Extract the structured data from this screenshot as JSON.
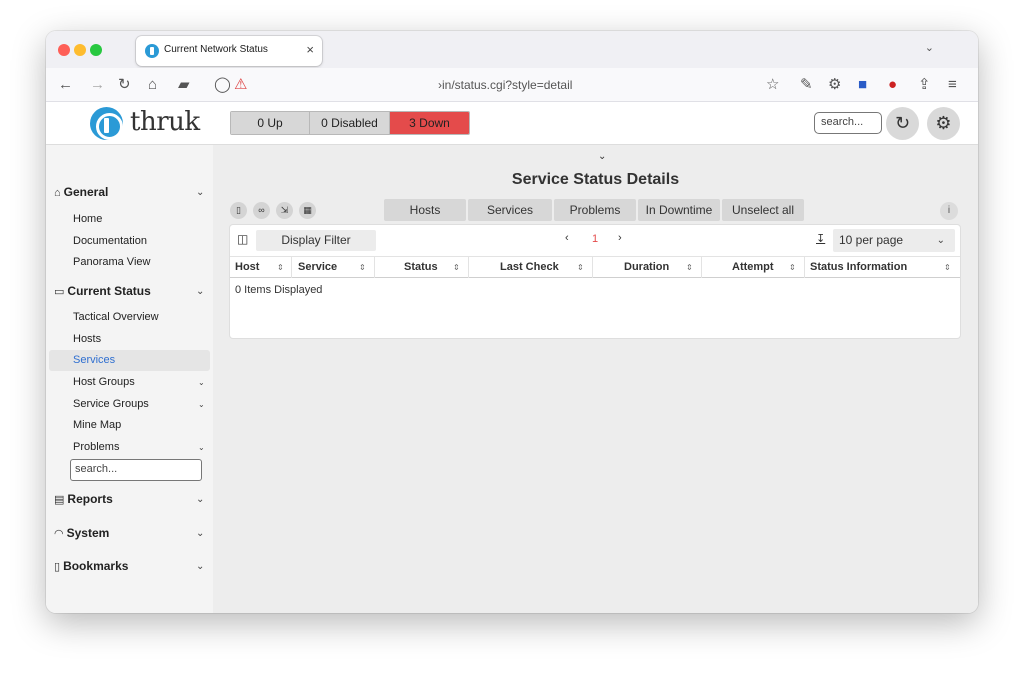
{
  "browser": {
    "tab_title": "Current Network Status",
    "tab_close": "×",
    "tab_list": "⌄",
    "url": "›in/status.cgi?style=detail"
  },
  "header": {
    "logo_text": "thruk",
    "status_up": "0 Up",
    "status_disabled": "0 Disabled",
    "status_down": "3 Down",
    "status_down_color": "#e44b4b",
    "search_placeholder": "search..."
  },
  "sidebar": {
    "sections": [
      {
        "label": "General",
        "icon": "home-icon"
      },
      {
        "label": "Current Status",
        "icon": "monitor-icon"
      },
      {
        "label": "Reports",
        "icon": "report-icon"
      },
      {
        "label": "System",
        "icon": "gauge-icon"
      },
      {
        "label": "Bookmarks",
        "icon": "bookmark-icon"
      }
    ],
    "general_items": [
      "Home",
      "Documentation",
      "Panorama View"
    ],
    "status_items": [
      "Tactical Overview",
      "Hosts",
      "Services",
      "Host Groups",
      "Service Groups",
      "Mine Map",
      "Problems"
    ],
    "active_item": "Services",
    "active_color": "#2f6fd0",
    "search_placeholder": "search...",
    "collapse_label": "‹‹",
    "scroll_top_label": "⌃"
  },
  "main": {
    "title": "Service Status Details",
    "filter_buttons": [
      "Hosts",
      "Services",
      "Problems",
      "In Downtime",
      "Unselect all"
    ],
    "display_filter": "Display Filter",
    "page_prev": "‹",
    "current_page": "1",
    "page_next": "›",
    "per_page": "10 per page",
    "columns": [
      "Host",
      "Service",
      "Status",
      "Last Check",
      "Duration",
      "Attempt",
      "Status Information"
    ],
    "items_displayed": "0 Items Displayed",
    "info_label": "i"
  }
}
